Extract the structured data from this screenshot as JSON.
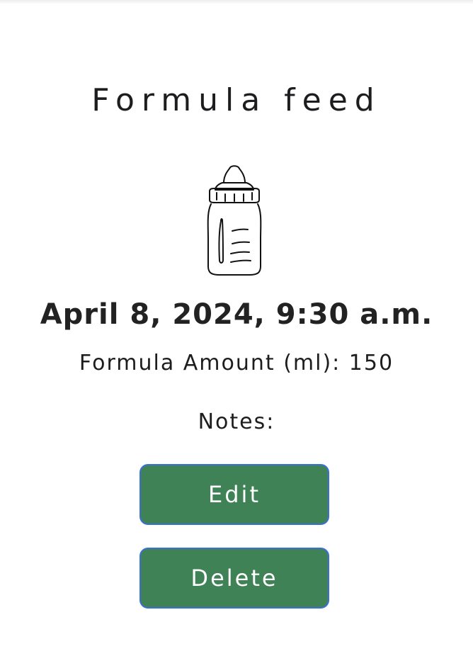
{
  "feed": {
    "title": "Formula feed",
    "datetime": "April 8, 2024, 9:30 a.m.",
    "amount_label": "Formula Amount (ml): 150",
    "notes_label": "Notes:"
  },
  "actions": {
    "edit_label": "Edit",
    "delete_label": "Delete"
  },
  "icons": {
    "bottle": "baby-bottle-icon"
  },
  "colors": {
    "button_bg": "#3f8256",
    "button_border": "#3a6fd8",
    "text": "#1d1d1f"
  }
}
